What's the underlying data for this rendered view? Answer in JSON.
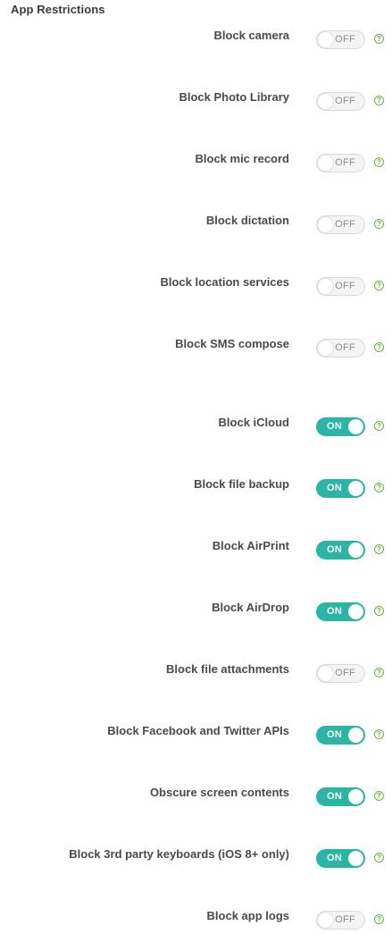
{
  "section": {
    "title": "App Restrictions"
  },
  "labels": {
    "on": "ON",
    "off": "OFF",
    "help": "?"
  },
  "colors": {
    "toggle_on": "#2bb5a5",
    "toggle_off": "#f4f4f4",
    "help_icon": "#6ab63c"
  },
  "settings": [
    {
      "label": "Block camera",
      "enabled": false
    },
    {
      "label": "Block Photo Library",
      "enabled": false
    },
    {
      "label": "Block mic record",
      "enabled": false
    },
    {
      "label": "Block dictation",
      "enabled": false
    },
    {
      "label": "Block location services",
      "enabled": false
    },
    {
      "label": "Block SMS compose",
      "enabled": false
    },
    {
      "label": "Block iCloud",
      "enabled": true
    },
    {
      "label": "Block file backup",
      "enabled": true
    },
    {
      "label": "Block AirPrint",
      "enabled": true
    },
    {
      "label": "Block AirDrop",
      "enabled": true
    },
    {
      "label": "Block file attachments",
      "enabled": false
    },
    {
      "label": "Block Facebook and Twitter APIs",
      "enabled": true
    },
    {
      "label": "Obscure screen contents",
      "enabled": true
    },
    {
      "label": "Block 3rd party keyboards (iOS 8+ only)",
      "enabled": true
    },
    {
      "label": "Block app logs",
      "enabled": false
    }
  ]
}
